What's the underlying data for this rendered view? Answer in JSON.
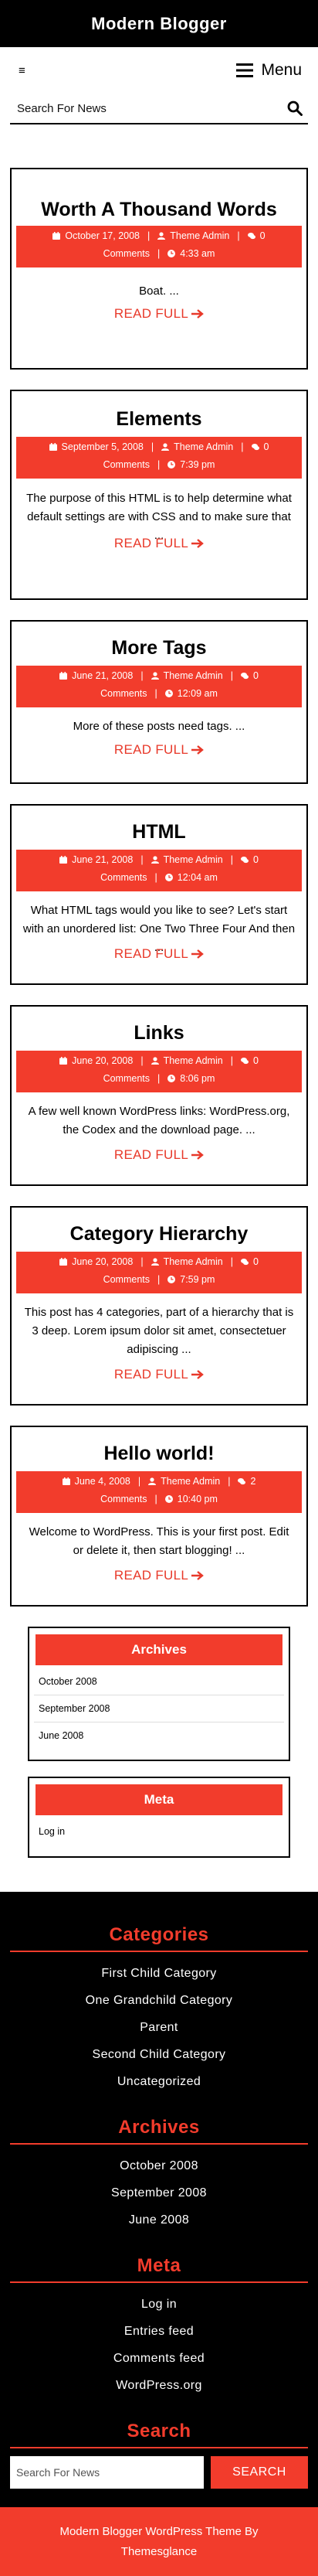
{
  "header": {
    "site_title": "Modern Blogger"
  },
  "nav": {
    "small_toggle_icon": "≡",
    "menu_label": "Menu"
  },
  "search": {
    "placeholder": "Search For News"
  },
  "posts": [
    {
      "title": "Worth A Thousand Words",
      "date": "October 17, 2008",
      "author": "Theme Admin",
      "comments": "0",
      "comments_label": "Comments",
      "time": "4:33 am",
      "excerpt": "Boat. ...",
      "read_more": "READ FULL"
    },
    {
      "title": "Elements",
      "date": "September 5, 2008",
      "author": "Theme Admin",
      "comments": "0",
      "comments_label": "Comments",
      "time": "7:39 pm",
      "excerpt": "The purpose of this HTML is to help determine what default settings are with CSS and to make sure that ...",
      "read_more": "READ FULL"
    },
    {
      "title": "More Tags",
      "date": "June 21, 2008",
      "author": "Theme Admin",
      "comments": "0",
      "comments_label": "Comments",
      "time": "12:09 am",
      "excerpt": "More of these posts need tags. ...",
      "read_more": "READ FULL"
    },
    {
      "title": "HTML",
      "date": "June 21, 2008",
      "author": "Theme Admin",
      "comments": "0",
      "comments_label": "Comments",
      "time": "12:04 am",
      "excerpt": "What HTML tags would you like to see? Let's start with an unordered list: One Two Three Four And then ...",
      "read_more": "READ FULL"
    },
    {
      "title": "Links",
      "date": "June 20, 2008",
      "author": "Theme Admin",
      "comments": "0",
      "comments_label": "Comments",
      "time": "8:06 pm",
      "excerpt": "A few well known WordPress links: WordPress.org, the Codex and the download page. ...",
      "read_more": "READ FULL"
    },
    {
      "title": "Category Hierarchy",
      "date": "June 20, 2008",
      "author": "Theme Admin",
      "comments": "0",
      "comments_label": "Comments",
      "time": "7:59 pm",
      "excerpt": "This post has 4 categories, part of a hierarchy that is 3 deep. Lorem ipsum dolor sit amet, consectetuer adipiscing ...",
      "read_more": "READ FULL"
    },
    {
      "title": "Hello world!",
      "date": "June 4, 2008",
      "author": "Theme Admin",
      "comments": "2",
      "comments_label": "Comments",
      "time": "10:40 pm",
      "excerpt": "Welcome to WordPress. This is your first post. Edit or delete it, then start blogging! ...",
      "read_more": "READ FULL"
    }
  ],
  "sidebar": {
    "archives_title": "Archives",
    "archives": [
      "October 2008",
      "September 2008",
      "June 2008"
    ],
    "meta_title": "Meta",
    "meta": [
      "Log in"
    ]
  },
  "footer": {
    "categories_title": "Categories",
    "categories": [
      "First Child Category",
      "One Grandchild Category",
      "Parent",
      "Second Child Category",
      "Uncategorized"
    ],
    "archives_title": "Archives",
    "archives": [
      "October 2008",
      "September 2008",
      "June 2008"
    ],
    "meta_title": "Meta",
    "meta": [
      "Log in",
      "Entries feed",
      "Comments feed",
      "WordPress.org"
    ],
    "search_title": "Search",
    "search_placeholder": "Search For News",
    "search_button": "SEARCH",
    "credit_line1": "Modern Blogger WordPress Theme By",
    "credit_line2": "Themesglance"
  },
  "colors": {
    "accent": "#f23c2c",
    "dark": "#000000"
  },
  "icons": {
    "calendar": "calendar-icon",
    "user": "user-icon",
    "comments": "comments-icon",
    "clock": "clock-icon",
    "search": "search-icon",
    "menu": "menu-icon",
    "arrow": "arrow-right-icon"
  }
}
